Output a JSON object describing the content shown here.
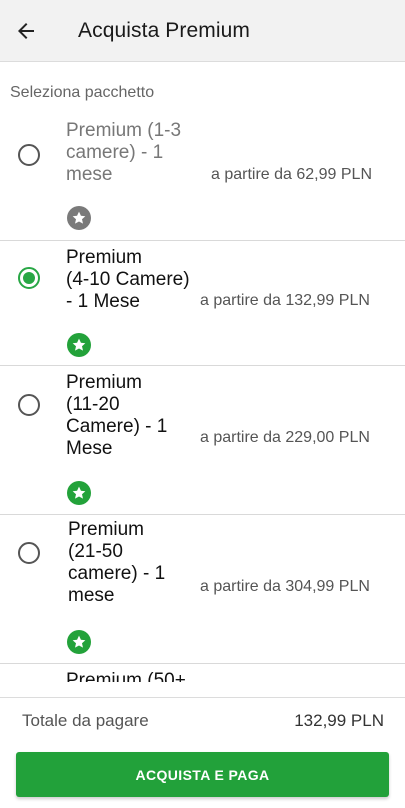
{
  "header": {
    "title": "Acquista Premium",
    "back_icon": "arrow-left-icon"
  },
  "section_label": "Seleziona pacchetto",
  "packages": [
    {
      "name_lines": [
        "Premium (1-3",
        "camere) - 1",
        "mese"
      ],
      "price": "a partire da 62,99 PLN",
      "selected": false,
      "star_color": "#7a7a7a"
    },
    {
      "name_lines": [
        "Premium",
        "(4-10 Camere)",
        "- 1 Mese"
      ],
      "price": "a partire da 132,99 PLN",
      "selected": true,
      "star_color": "#23a23a"
    },
    {
      "name_lines": [
        "Premium",
        "(11-20",
        "Camere) - 1",
        "Mese"
      ],
      "price": "a partire da 229,00 PLN",
      "selected": false,
      "star_color": "#23a23a"
    },
    {
      "name_lines": [
        "Premium",
        "(21-50",
        "camere) - 1",
        "mese"
      ],
      "price": "a partire da 304,99 PLN",
      "selected": false,
      "star_color": "#23a23a"
    },
    {
      "name_lines": [
        "Premium (50+"
      ],
      "price": "",
      "selected": false,
      "star_color": "#23a23a"
    }
  ],
  "footer": {
    "total_label": "Totale da pagare",
    "total_value": "132,99 PLN",
    "pay_button": "ACQUISTA E PAGA"
  },
  "colors": {
    "accent": "#22a13a",
    "appbar": "#f2f2f2"
  }
}
